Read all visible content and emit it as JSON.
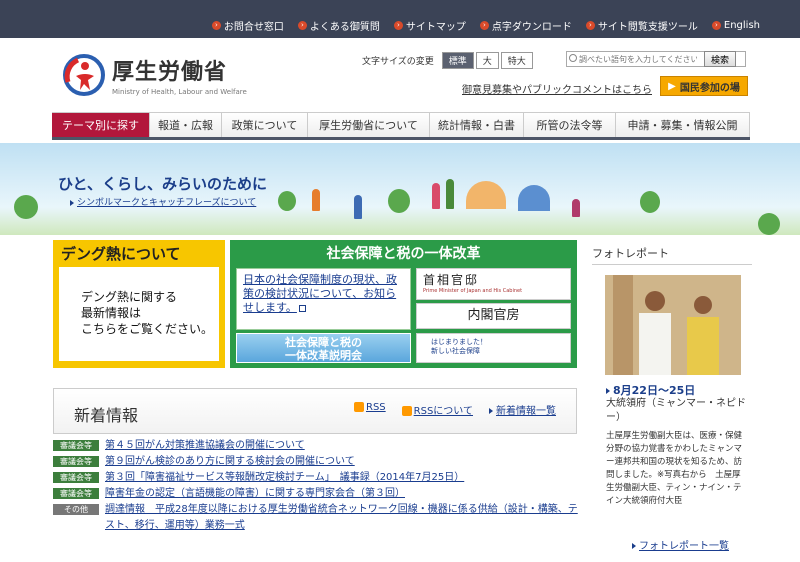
{
  "top_links": [
    "お問合せ窓口",
    "よくある御質問",
    "サイトマップ",
    "点字ダウンロード",
    "サイト閲覧支援ツール",
    "English"
  ],
  "logo": {
    "title": "厚生労働省",
    "subtitle": "Ministry of Health, Labour and Welfare"
  },
  "font_size": {
    "label": "文字サイズの変更",
    "options": [
      "標準",
      "大",
      "特大"
    ],
    "selected": "標準"
  },
  "search": {
    "placeholder": "調べたい語句を入力してください",
    "button": "検索"
  },
  "public_comment": "御意見募集やパブリックコメントはこちら",
  "kokumin_button": "国民参加の場",
  "global_nav": [
    "テーマ別に探す",
    "報道・広報",
    "政策について",
    "厚生労働省について",
    "統計情報・白書",
    "所管の法令等",
    "申請・募集・情報公開"
  ],
  "hero": {
    "title": "ひと、くらし、みらいのために",
    "link": "シンボルマークとキャッチフレーズについて"
  },
  "dengue": {
    "title": "デング熱について",
    "body_lines": [
      "デング熱に関する",
      "最新情報は",
      "こちらをご覧ください。"
    ]
  },
  "shakai": {
    "title": "社会保障と税の一体改革",
    "left_text": "日本の社会保障制度の現状、政策の検討状況について、お知らせします。",
    "setsumei_lines": [
      "社会保障と税の",
      "一体改革説明会"
    ],
    "kantei_title": "首相官邸",
    "kantei_sub": "Prime Minister of Japan and His Cabinet",
    "naikaku": "内閣官房",
    "hajime_lines": [
      "はじまりました！",
      "新しい社会保障"
    ]
  },
  "photo_report": {
    "heading": "フォトレポート",
    "date": "8月22日～25日",
    "place": "大統領府（ミャンマー・ネピドー）",
    "description": "土屋厚生労働副大臣は、医療・保健分野の協力覚書をかわしたミャンマー連邦共和国の現状を知るため、訪問しました。※写真右から　土屋厚生労働副大臣、ティン・ナイン・テイン大統領府付大臣",
    "more_link": "フォトレポート一覧"
  },
  "news": {
    "title": "新着情報",
    "links": [
      "RSS",
      "RSSについて",
      "新着情報一覧"
    ],
    "items": [
      {
        "badge": "審議会等",
        "text": "第４５回がん対策推進協議会の開催について"
      },
      {
        "badge": "審議会等",
        "text": "第９回がん検診のあり方に関する検討会の開催について"
      },
      {
        "badge": "審議会等",
        "text": "第３回「障害福祉サービス等報酬改定検討チーム」　議事録（2014年7月25日）"
      },
      {
        "badge": "審議会等",
        "text": "障害年金の認定（言語機能の障害）に関する専門家会合（第３回）"
      },
      {
        "badge": "その他",
        "text": "調達情報　平成28年度以降における厚生労働省統合ネットワーク回線・機器に係る供給（設計・構築、テスト、移行、運用等）業務一式"
      }
    ]
  },
  "colors": {
    "topbar": "#3b4356",
    "nav_active": "#b2173b",
    "dengue": "#f7c600",
    "shakai": "#2b9b48",
    "link": "#1a3d8f"
  }
}
